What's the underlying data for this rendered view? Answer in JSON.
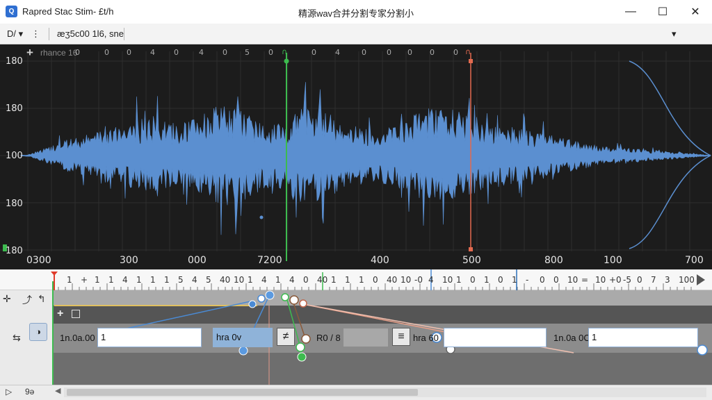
{
  "window": {
    "app_name": "Rapred Stac Stim- £t/h",
    "title": "精源wav合并分割专家分割小",
    "minimize": "—",
    "maximize": "☐",
    "close": "✕"
  },
  "toolbar": {
    "menu_label": "D/ ▾",
    "more": "⋮",
    "filename": "æӡ5c00 1l6, sne",
    "dropdown": "▾"
  },
  "waveform": {
    "track_label": "rhance 16",
    "add_icon": "plus-icon",
    "top_labels": [
      "0",
      "0",
      "0",
      "4",
      "0",
      "4",
      "0",
      "5",
      "0",
      "0",
      "4",
      "0",
      "0",
      "0",
      "0",
      "0"
    ],
    "y_labels": [
      "180",
      "180",
      "100",
      "180",
      "180"
    ],
    "x_labels": [
      "0300",
      "300",
      "000",
      "7200",
      "400",
      "500",
      "800",
      "100",
      "700"
    ],
    "waveform_color": "#5b8fd0",
    "cursor_green": "#3dbb4f",
    "cursor_red": "#e36a4f"
  },
  "ruler": {
    "labels": [
      "1",
      "+",
      "1",
      "1",
      "4",
      "1",
      "1",
      "1",
      "5",
      "4",
      "5",
      "40",
      "10",
      "1",
      "4",
      "1",
      "4",
      "0",
      "40",
      "1",
      "1",
      "1",
      "0",
      "40",
      "10",
      "-0",
      "4",
      "10",
      "1",
      "0",
      "1",
      "0",
      "1",
      "-",
      "0",
      "0",
      "10",
      "=",
      "10",
      "+0",
      "-5",
      "0",
      "7",
      "3",
      "100"
    ],
    "play_icon": "play-icon"
  },
  "editor": {
    "start_label": "1n.0a.00",
    "start_value": "1",
    "mid_label": "hra 0v",
    "ratio_label": "R0 / 8",
    "end_label": "hra 60",
    "end_time_label": "1n.0a 0C",
    "end_value": "1"
  },
  "status": {
    "play": "▷",
    "value": "9ə"
  }
}
